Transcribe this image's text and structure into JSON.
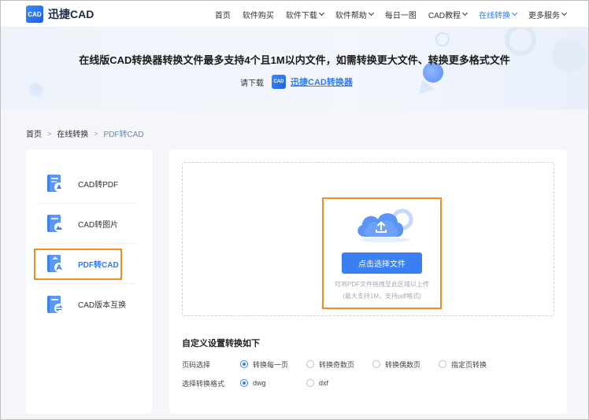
{
  "header": {
    "logo_mark": "CAD",
    "logo_text": "迅捷CAD",
    "nav": [
      {
        "label": "首页",
        "dropdown": false,
        "active": false
      },
      {
        "label": "软件购买",
        "dropdown": false,
        "active": false
      },
      {
        "label": "软件下载",
        "dropdown": true,
        "active": false
      },
      {
        "label": "软件帮助",
        "dropdown": true,
        "active": false
      },
      {
        "label": "每日一图",
        "dropdown": false,
        "active": false
      },
      {
        "label": "CAD教程",
        "dropdown": true,
        "active": false
      },
      {
        "label": "在线转换",
        "dropdown": true,
        "active": true
      },
      {
        "label": "更多服务",
        "dropdown": true,
        "active": false
      }
    ]
  },
  "banner": {
    "title": "在线版CAD转换器转换文件最多支持4个且1M以内文件，如需转换更大文件、转换更多格式文件",
    "download_prefix": "请下载",
    "download_link": "迅捷CAD转换器"
  },
  "breadcrumb": {
    "items": [
      "首页",
      "在线转换",
      "PDF转CAD"
    ],
    "separator": ">"
  },
  "sidebar": {
    "items": [
      {
        "label": "CAD转PDF",
        "icon": "cad-to-pdf-icon",
        "active": false
      },
      {
        "label": "CAD转图片",
        "icon": "cad-to-image-icon",
        "active": false
      },
      {
        "label": "PDF转CAD",
        "icon": "pdf-to-cad-icon",
        "active": true
      },
      {
        "label": "CAD版本互换",
        "icon": "cad-version-swap-icon",
        "active": false
      }
    ]
  },
  "upload": {
    "button_label": "点击选择文件",
    "hint_line1": "可将PDF文件拖拽至此区域以上传",
    "hint_line2": "(最大支持1M，支持pdf格式)"
  },
  "settings": {
    "title": "自定义设置转换如下",
    "page_select": {
      "label": "页码选择",
      "options": [
        "转换每一页",
        "转换奇数页",
        "转换偶数页",
        "指定页转换"
      ],
      "selected": "转换每一页"
    },
    "format_select": {
      "label": "选择转换格式",
      "options": [
        "dwg",
        "dxf"
      ],
      "selected": "dwg"
    }
  },
  "colors": {
    "accent": "#2f7cf6",
    "button": "#3b7ff5",
    "highlight_box": "#f08c1d"
  }
}
